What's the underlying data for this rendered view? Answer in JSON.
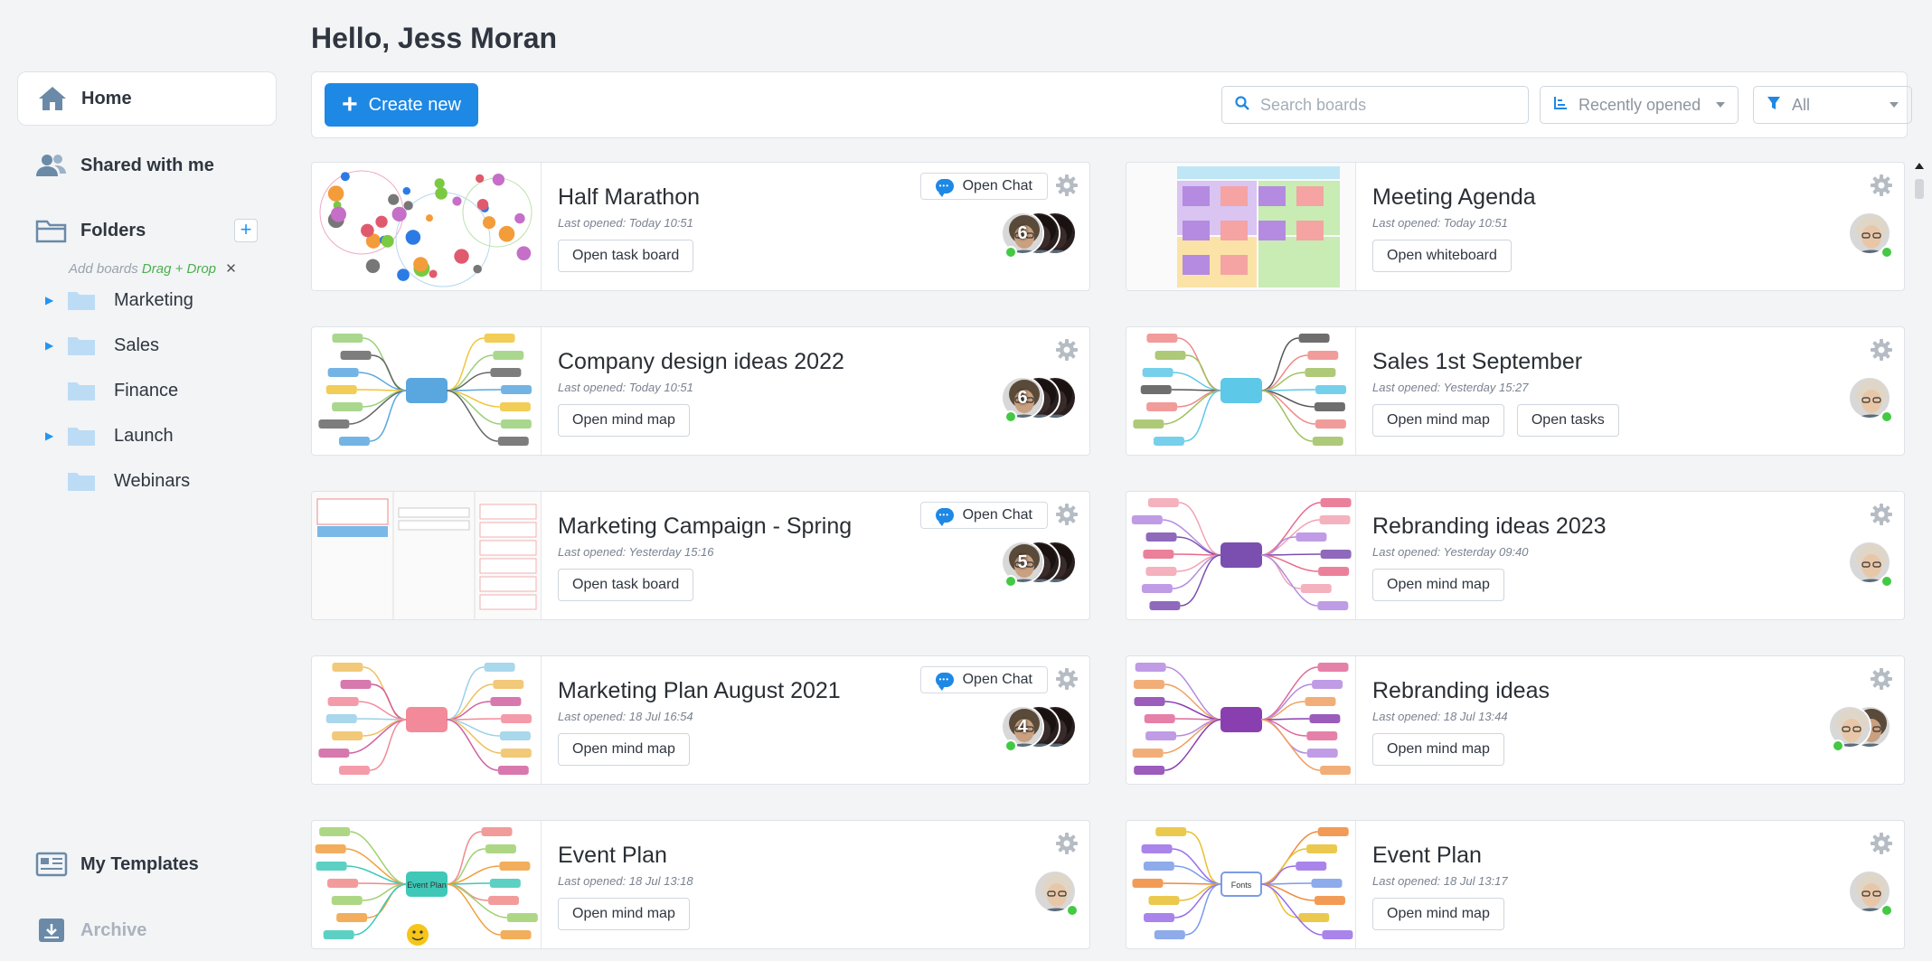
{
  "greeting": "Hello, Jess Moran",
  "sidebar": {
    "home_label": "Home",
    "shared_label": "Shared with me",
    "folders_label": "Folders",
    "add_boards_text": "Add boards",
    "drag_drop_text": "Drag + Drop",
    "folders": [
      {
        "name": "Marketing",
        "expandable": true
      },
      {
        "name": "Sales",
        "expandable": true
      },
      {
        "name": "Finance",
        "expandable": false
      },
      {
        "name": "Launch",
        "expandable": true
      },
      {
        "name": "Webinars",
        "expandable": false
      }
    ],
    "templates_label": "My Templates",
    "archive_label": "Archive"
  },
  "toolbar": {
    "create_label": "Create new",
    "search_placeholder": "Search boards",
    "sort_value": "Recently opened",
    "filter_value": "All"
  },
  "colors": {
    "accent": "#1e88e5",
    "online": "#43c943",
    "folder": "#bcdcf5"
  },
  "cards": [
    {
      "title": "Half Marathon",
      "time": "Last opened: Today 10:51",
      "buttons": [
        "Open task board"
      ],
      "chat": "Open Chat",
      "avatar_count": "6",
      "thumb": "bubbles"
    },
    {
      "title": "Meeting Agenda",
      "time": "Last opened: Today 10:51",
      "buttons": [
        "Open whiteboard"
      ],
      "chat": null,
      "avatar_count": null,
      "thumb": "sticky"
    },
    {
      "title": "Company design ideas 2022",
      "time": "Last opened: Today 10:51",
      "buttons": [
        "Open mind map"
      ],
      "chat": null,
      "avatar_count": "6",
      "thumb": "mindmap-dark"
    },
    {
      "title": "Sales 1st September",
      "time": "Last opened: Yesterday 15:27",
      "buttons": [
        "Open mind map",
        "Open tasks"
      ],
      "chat": null,
      "avatar_count": null,
      "thumb": "mindmap-flow"
    },
    {
      "title": "Marketing Campaign - Spring",
      "time": "Last opened: Yesterday 15:16",
      "buttons": [
        "Open task board"
      ],
      "chat": "Open Chat",
      "avatar_count": "5",
      "thumb": "kanban"
    },
    {
      "title": "Rebranding ideas 2023",
      "time": "Last opened: Yesterday 09:40",
      "buttons": [
        "Open mind map"
      ],
      "chat": null,
      "avatar_count": null,
      "thumb": "mindmap-purple"
    },
    {
      "title": "Marketing Plan August 2021",
      "time": "Last opened: 18 Jul 16:54",
      "buttons": [
        "Open mind map"
      ],
      "chat": "Open Chat",
      "avatar_count": "4",
      "thumb": "mindmap-pink"
    },
    {
      "title": "Rebranding ideas",
      "time": "Last opened: 18 Jul 13:44",
      "buttons": [
        "Open mind map"
      ],
      "chat": null,
      "avatar_count": null,
      "thumb": "mindmap-purple2"
    },
    {
      "title": "Event Plan",
      "time": "Last opened: 18 Jul 13:18",
      "buttons": [
        "Open mind map"
      ],
      "chat": null,
      "avatar_count": null,
      "thumb": "mindmap-event"
    },
    {
      "title": "Event Plan",
      "time": "Last opened: 18 Jul 13:17",
      "buttons": [
        "Open mind map"
      ],
      "chat": null,
      "avatar_count": null,
      "thumb": "fonts"
    }
  ],
  "thumb_text": {
    "event_root": "Event Plan",
    "fonts_root": "Fonts"
  }
}
